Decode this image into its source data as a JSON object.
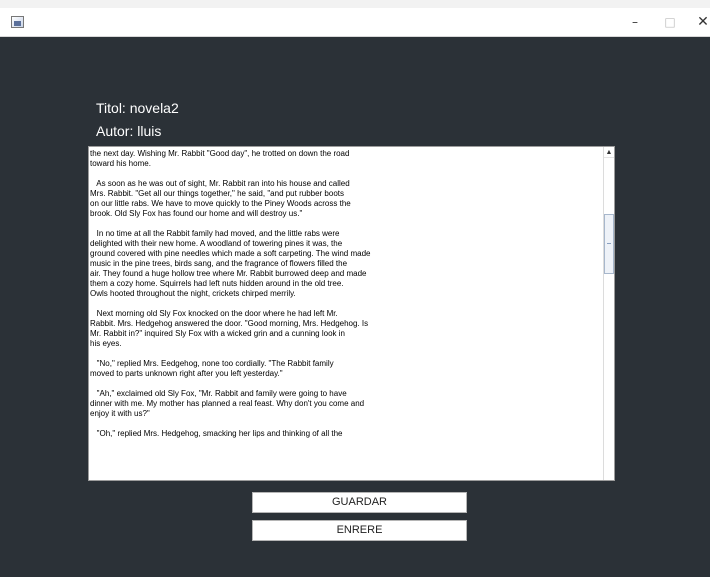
{
  "window": {
    "icon": "java-app-icon",
    "controls": {
      "minimize": "–",
      "maximize": "□",
      "close": "✕"
    }
  },
  "meta": {
    "title": "Titol: novela2",
    "author": "Autor: lluis"
  },
  "story_lines": [
    "the next day. Wishing Mr. Rabbit \"Good day\", he trotted on down the road",
    "toward his home.",
    "",
    "   As soon as he was out of sight, Mr. Rabbit ran into his house and called",
    "Mrs. Rabbit. \"Get all our things together,\" he said, \"and put rubber boots",
    "on our little rabs. We have to move quickly to the Piney Woods across the",
    "brook. Old Sly Fox has found our home and will destroy us.\"",
    "",
    "   In no time at all the Rabbit family had moved, and the little rabs were",
    "delighted with their new home. A woodland of towering pines it was, the",
    "ground covered with pine needles which made a soft carpeting. The wind made",
    "music in the pine trees, birds sang, and the fragrance of flowers filled the",
    "air. They found a huge hollow tree where Mr. Rabbit burrowed deep and made",
    "them a cozy home. Squirrels had left nuts hidden around in the old tree.",
    "Owls hooted throughout the night, crickets chirped merrily.",
    "",
    "   Next morning old Sly Fox knocked on the door where he had left Mr.",
    "Rabbit. Mrs. Hedgehog answered the door. \"Good morning, Mrs. Hedgehog. Is",
    "Mr. Rabbit in?\" inquired Sly Fox with a wicked grin and a cunning look in",
    "his eyes.",
    "",
    "   \"No,\" replied Mrs. Eedgehog, none too cordially. \"The Rabbit family",
    "moved to parts unknown right after you left yesterday.\"",
    "",
    "   \"Ah,\" exclaimed old Sly Fox, \"Mr. Rabbit and family were going to have",
    "dinner with me. My mother has planned a real feast. Why don't you come and",
    "enjoy it with us?\"",
    "",
    "   \"Oh,\" replied Mrs. Hedgehog, smacking her lips and thinking of all the"
  ],
  "scroll": {
    "up_arrow": "▲",
    "position": 0.25
  },
  "buttons": {
    "save": "GUARDAR",
    "back": "ENRERE"
  }
}
